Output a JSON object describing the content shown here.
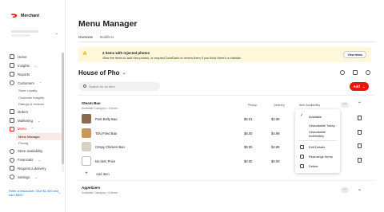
{
  "sidebar": {
    "brand": "Merchant",
    "nav": [
      {
        "label": "Home"
      },
      {
        "label": "Insights",
        "chevron": "⌄"
      },
      {
        "label": "Reports"
      },
      {
        "label": "Customers",
        "chevron": "⌃"
      }
    ],
    "customers_sub": [
      "Store Loyalty",
      "Customer insights",
      "Ratings & reviews"
    ],
    "nav2": [
      {
        "label": "Orders"
      },
      {
        "label": "Marketing",
        "chevron": "⌄"
      },
      {
        "label": "Menu",
        "chevron": "⌃"
      }
    ],
    "menu_sub": [
      "Menu Manager",
      "Pricing"
    ],
    "nav3": [
      {
        "label": "Store availability"
      },
      {
        "label": "Financials",
        "chevron": "⌄"
      },
      {
        "label": "Request a delivery"
      },
      {
        "label": "Settings",
        "chevron": "⌄"
      }
    ],
    "promo": "Refer a restaurant. Give $1,000 and earn $500",
    "promo_arrow": "→"
  },
  "main": {
    "title": "Menu Manager",
    "tabs": [
      {
        "label": "Overview"
      },
      {
        "label": "Modifiers"
      }
    ],
    "banner": {
      "title": "2 items with rejected photos",
      "text": "View the items to add new photos, or request DoorDash to review them if you think there's a mistake.",
      "button": "View items"
    },
    "menu_name": "House of Pho",
    "menu_chevron": "⌄",
    "search_placeholder": "Search for an item",
    "add_button": "Add",
    "add_chevron": "⌄",
    "category": {
      "name": "Steam Bao",
      "sub": "Available Category • 4 items",
      "col_pickup": "Pickup",
      "col_delivery": "Delivery",
      "col_availability": "Item Availability",
      "more": "…",
      "chevron": "⌃",
      "items": [
        {
          "name": "Pork Belly Bao",
          "pickup": "$5.01",
          "delivery": "$2.99"
        },
        {
          "name": "Tofu Fried Bao",
          "pickup": "$8.00",
          "delivery": "$4.99"
        },
        {
          "name": "Crispy Chicken Bao",
          "pickup": "$8.00",
          "delivery": "$4.99"
        },
        {
          "name": "No item Price",
          "pickup": "$0.00",
          "delivery": "$0.00"
        }
      ],
      "add_item": "Add Item",
      "add_plus": "+"
    },
    "dropdown": {
      "check": "✓",
      "items": [
        "Available",
        "Unavailable Today",
        "Unavailable Indefinitely",
        "Edit Details",
        "Rearrange Items",
        "Delete"
      ]
    },
    "category2": {
      "name": "Appetizers",
      "sub": "Available Category • 6 items",
      "more": "…",
      "chevron": "⌄"
    }
  },
  "colors": {
    "accent": "#eb1700",
    "banner_bg": "#fff7dc",
    "link": "#0b6fd8"
  }
}
